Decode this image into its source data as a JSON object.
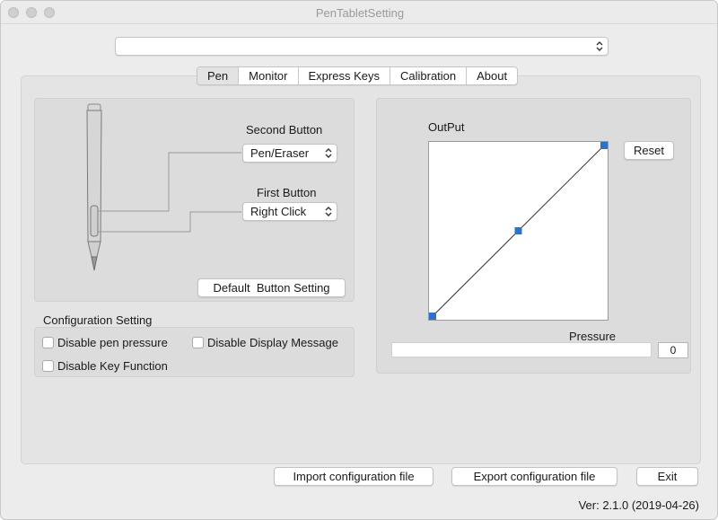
{
  "window": {
    "title": "PenTabletSetting"
  },
  "device_select": {
    "value": ""
  },
  "tabs": [
    {
      "label": "Pen",
      "active": true
    },
    {
      "label": "Monitor",
      "active": false
    },
    {
      "label": "Express Keys",
      "active": false
    },
    {
      "label": "Calibration",
      "active": false
    },
    {
      "label": "About",
      "active": false
    }
  ],
  "pen": {
    "second_button_label": "Second Button",
    "second_button_value": "Pen/Eraser",
    "first_button_label": "First Button",
    "first_button_value": "Right Click",
    "default_button_label": "Default  Button Setting"
  },
  "config": {
    "title": "Configuration Setting",
    "disable_pen_pressure": "Disable pen pressure",
    "disable_display_message": "Disable Display Message",
    "disable_key_function": "Disable Key Function"
  },
  "curve": {
    "output_label": "OutPut",
    "reset_label": "Reset",
    "pressure_label": "Pressure",
    "pressure_value": "0",
    "pressure_level": 0,
    "points": [
      [
        0,
        0
      ],
      [
        0.5,
        0.5
      ],
      [
        1,
        1
      ]
    ],
    "accent_color": "#2e6fd0"
  },
  "footer": {
    "import_label": "Import configuration file",
    "export_label": "Export configuration file",
    "exit_label": "Exit",
    "version": "Ver: 2.1.0 (2019-04-26)"
  }
}
